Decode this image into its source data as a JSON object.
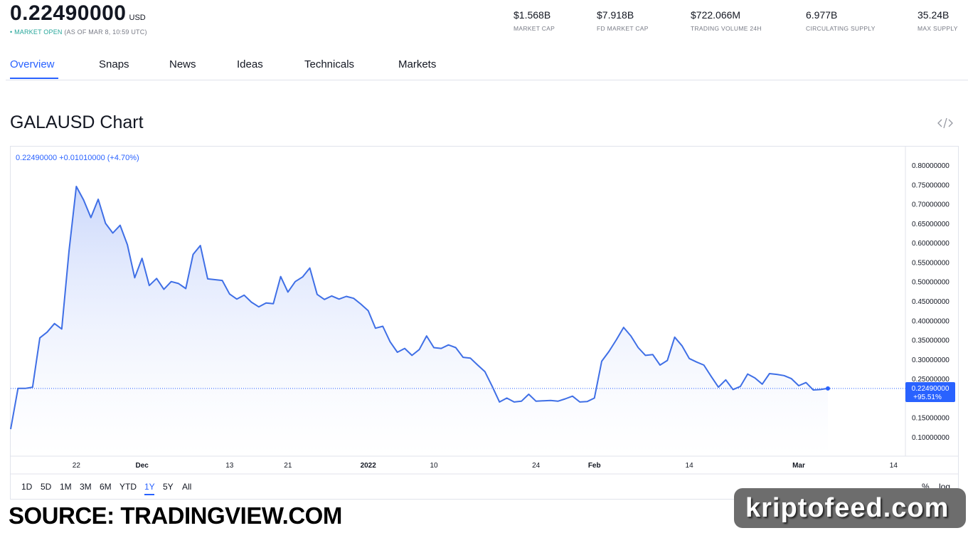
{
  "header": {
    "price": "0.22490000",
    "currency": "USD",
    "status_dot": "•",
    "status_open": "MARKET OPEN",
    "status_time": "(AS OF MAR 8, 10:59 UTC)"
  },
  "stats": [
    {
      "value": "$1.568B",
      "label": "MARKET CAP"
    },
    {
      "value": "$7.918B",
      "label": "FD MARKET CAP"
    },
    {
      "value": "$722.066M",
      "label": "TRADING VOLUME 24H"
    },
    {
      "value": "6.977B",
      "label": "CIRCULATING SUPPLY"
    },
    {
      "value": "35.24B",
      "label": "MAX SUPPLY"
    }
  ],
  "tabs": [
    "Overview",
    "Snaps",
    "News",
    "Ideas",
    "Technicals",
    "Markets"
  ],
  "active_tab": "Overview",
  "chart_title": "GALAUSD Chart",
  "embed_icon": "code-embed-icon",
  "legend": "0.22490000 +0.01010000 (+4.70%)",
  "price_label": {
    "value": "0.22490000",
    "change": "+95.51%"
  },
  "ranges": [
    "1D",
    "5D",
    "1M",
    "3M",
    "6M",
    "YTD",
    "1Y",
    "5Y",
    "All"
  ],
  "active_range": "1Y",
  "scale_options": [
    "%",
    "log"
  ],
  "source_text": "SOURCE: TRADINGVIEW.COM",
  "brand_text": "kriptofeed.com",
  "colors": {
    "accent": "#2962ff",
    "line": "#3f6fe6",
    "fill_top": "#c9d6fb",
    "green": "#26a69a"
  },
  "chart_data": {
    "type": "area",
    "title": "",
    "xlabel": "",
    "ylabel": "",
    "ylim": [
      0.05,
      0.85
    ],
    "y_ticks": [
      "0.80000000",
      "0.75000000",
      "0.70000000",
      "0.65000000",
      "0.60000000",
      "0.55000000",
      "0.50000000",
      "0.45000000",
      "0.40000000",
      "0.35000000",
      "0.30000000",
      "0.25000000",
      "0.15000000",
      "0.10000000"
    ],
    "x_ticks": [
      {
        "label": "22",
        "x": 9
      },
      {
        "label": "Dec",
        "x": 18
      },
      {
        "label": "13",
        "x": 30
      },
      {
        "label": "21",
        "x": 38
      },
      {
        "label": "2022",
        "x": 49
      },
      {
        "label": "10",
        "x": 58
      },
      {
        "label": "24",
        "x": 72
      },
      {
        "label": "Feb",
        "x": 80
      },
      {
        "label": "14",
        "x": 93
      },
      {
        "label": "Mar",
        "x": 108
      },
      {
        "label": "14",
        "x": 121
      }
    ],
    "last_value": 0.2249,
    "series": [
      {
        "values": [
          0.12,
          0.225,
          0.225,
          0.228,
          0.355,
          0.37,
          0.392,
          0.378,
          0.58,
          0.745,
          0.71,
          0.665,
          0.712,
          0.65,
          0.625,
          0.645,
          0.595,
          0.51,
          0.56,
          0.49,
          0.508,
          0.48,
          0.5,
          0.495,
          0.482,
          0.57,
          0.593,
          0.507,
          0.505,
          0.503,
          0.468,
          0.455,
          0.465,
          0.447,
          0.435,
          0.445,
          0.443,
          0.513,
          0.473,
          0.5,
          0.512,
          0.535,
          0.467,
          0.454,
          0.463,
          0.455,
          0.462,
          0.457,
          0.442,
          0.425,
          0.38,
          0.385,
          0.345,
          0.318,
          0.328,
          0.31,
          0.325,
          0.36,
          0.33,
          0.328,
          0.337,
          0.33,
          0.305,
          0.303,
          0.285,
          0.268,
          0.23,
          0.19,
          0.2,
          0.19,
          0.192,
          0.21,
          0.192,
          0.193,
          0.194,
          0.192,
          0.198,
          0.205,
          0.19,
          0.191,
          0.2,
          0.295,
          0.32,
          0.35,
          0.382,
          0.36,
          0.33,
          0.31,
          0.312,
          0.285,
          0.297,
          0.357,
          0.335,
          0.302,
          0.293,
          0.285,
          0.256,
          0.228,
          0.247,
          0.222,
          0.23,
          0.262,
          0.252,
          0.236,
          0.263,
          0.261,
          0.258,
          0.25,
          0.232,
          0.24,
          0.221,
          0.222,
          0.2249
        ]
      }
    ]
  }
}
